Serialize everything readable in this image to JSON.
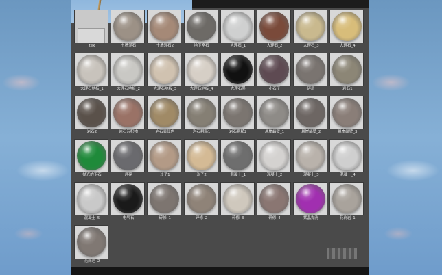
{
  "materials": [
    {
      "label": "tex",
      "color": "#dcdcdc",
      "flat": true
    },
    {
      "label": "土墙混石",
      "color": "#9c9186"
    },
    {
      "label": "土墙混石2",
      "color": "#a58977"
    },
    {
      "label": "地下室石",
      "color": "#6d6a66"
    },
    {
      "label": "大理石_1",
      "color": "#cfd0d0"
    },
    {
      "label": "大理石_2",
      "color": "#7a4a3a"
    },
    {
      "label": "大理石_3",
      "color": "#c9b98e"
    },
    {
      "label": "大理石_4",
      "color": "#d8bd7a"
    },
    {
      "label": "大理石地板_1",
      "color": "#c8c3bc"
    },
    {
      "label": "大理石地板_2",
      "color": "#c9c8c4"
    },
    {
      "label": "大理石地板_3",
      "color": "#d0c2b0"
    },
    {
      "label": "大理石地板_4",
      "color": "#d6cfc6"
    },
    {
      "label": "大理石黑",
      "color": "#111111"
    },
    {
      "label": "小石子",
      "color": "#5e4a52"
    },
    {
      "label": "碎屑",
      "color": "#7a7470"
    },
    {
      "label": "岩石1",
      "color": "#8c8676"
    },
    {
      "label": "岩石2",
      "color": "#5a514a"
    },
    {
      "label": "岩石沉积物",
      "color": "#9a7266"
    },
    {
      "label": "岩石表红色",
      "color": "#a08a66"
    },
    {
      "label": "岩石粗糙1",
      "color": "#857f74"
    },
    {
      "label": "岩石粗糙2",
      "color": "#7b7570"
    },
    {
      "label": "悬崖峭壁_1",
      "color": "#8e8b87"
    },
    {
      "label": "悬崖峭壁_2",
      "color": "#6d6663"
    },
    {
      "label": "悬崖峭壁_3",
      "color": "#8a7e78"
    },
    {
      "label": "抛光的玉石",
      "color": "#1f8a3a"
    },
    {
      "label": "月亮",
      "color": "#6a6a6e"
    },
    {
      "label": "沙子1",
      "color": "#b39a86"
    },
    {
      "label": "沙子2",
      "color": "#d4ba95"
    },
    {
      "label": "混凝土_1",
      "color": "#6e6e6e"
    },
    {
      "label": "混凝土_2",
      "color": "#d4d2d0"
    },
    {
      "label": "混凝土_3",
      "color": "#b9b2ab"
    },
    {
      "label": "混凝土_4",
      "color": "#cfcfcf"
    },
    {
      "label": "混凝土_5",
      "color": "#c9c9c9"
    },
    {
      "label": "电气石",
      "color": "#1a1a1a"
    },
    {
      "label": "碎修_1",
      "color": "#7d7570"
    },
    {
      "label": "碎修_2",
      "color": "#8f8378"
    },
    {
      "label": "碎修_3",
      "color": "#cfc8bd"
    },
    {
      "label": "碎修_4",
      "color": "#8a7672"
    },
    {
      "label": "紫晶抛光",
      "color": "#a12fb0"
    },
    {
      "label": "花岗岩_1",
      "color": "#a9a39c"
    },
    {
      "label": "花岗岩_2",
      "color": "#807873"
    }
  ]
}
